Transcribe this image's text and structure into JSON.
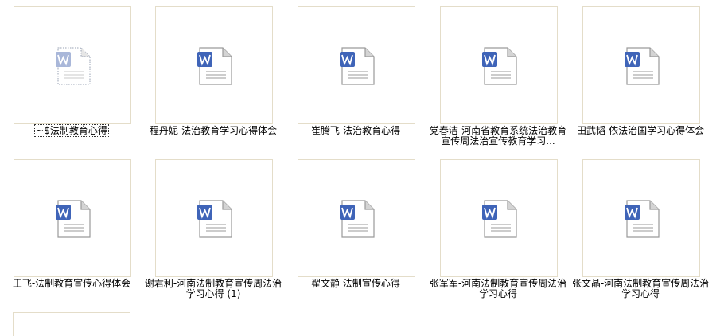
{
  "files": [
    {
      "name": "~$法制教育心得",
      "icon": "doc-temp-icon",
      "selected": true
    },
    {
      "name": "程丹妮-法治教育学习心得体会",
      "icon": "wps-doc-icon"
    },
    {
      "name": "崔腾飞-法治教育心得",
      "icon": "wps-doc-icon"
    },
    {
      "name": "党春洁-河南省教育系统法治教育宣传周法治宣传教育学习...",
      "icon": "wps-doc-icon"
    },
    {
      "name": "田武韬-依法治国学习心得体会",
      "icon": "wps-doc-icon"
    },
    {
      "name": "王飞-法制教育宣传心得体会",
      "icon": "wps-doc-icon"
    },
    {
      "name": "谢君利-河南法制教育宣传周法治学习心得 (1)",
      "icon": "wps-doc-icon"
    },
    {
      "name": "翟文静 法制宣传心得",
      "icon": "wps-doc-icon"
    },
    {
      "name": "张军军-河南法制教育宣传周法治学习心得",
      "icon": "wps-doc-icon"
    },
    {
      "name": "张文晶-河南法制教育宣传周法治学习心得",
      "icon": "wps-doc-icon"
    }
  ],
  "colors": {
    "wps_blue": "#3f64b8",
    "page_gray": "#9a9a9a",
    "thumb_border": "#e4ddc9"
  }
}
